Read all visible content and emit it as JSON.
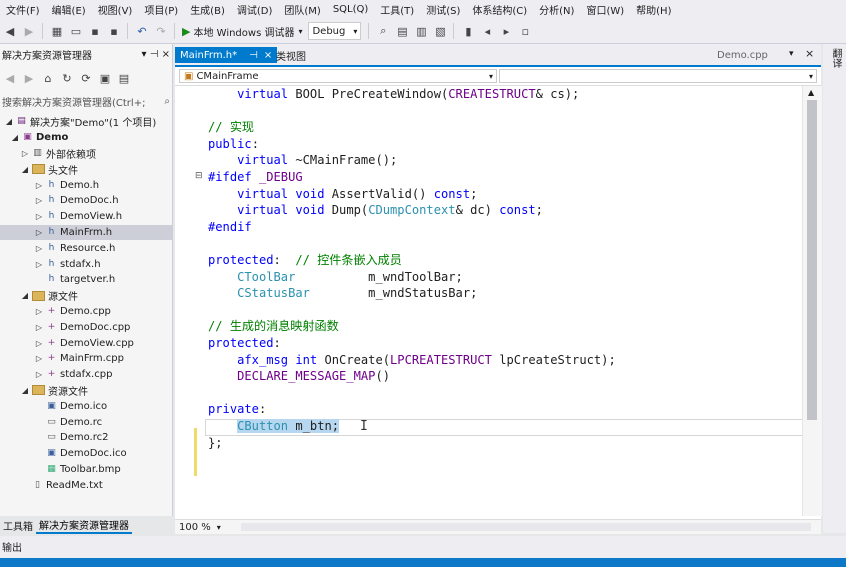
{
  "menu": [
    "文件(F)",
    "编辑(E)",
    "视图(V)",
    "项目(P)",
    "生成(B)",
    "调试(D)",
    "团队(M)",
    "SQL(Q)",
    "工具(T)",
    "测试(S)",
    "体系结构(C)",
    "分析(N)",
    "窗口(W)",
    "帮助(H)"
  ],
  "toolbar": {
    "debug_label": "本地 Windows 调试器",
    "config": "Debug"
  },
  "solution_explorer": {
    "title": "解决方案资源管理器",
    "search_placeholder": "搜索解决方案资源管理器(Ctrl+;",
    "solution_label": "解决方案\"Demo\"(1 个项目)",
    "project": "Demo",
    "external": "外部依赖项",
    "headers_folder": "头文件",
    "headers": [
      "Demo.h",
      "DemoDoc.h",
      "DemoView.h",
      "MainFrm.h",
      "Resource.h",
      "stdafx.h",
      "targetver.h"
    ],
    "sources_folder": "源文件",
    "sources": [
      "Demo.cpp",
      "DemoDoc.cpp",
      "DemoView.cpp",
      "MainFrm.cpp",
      "stdafx.cpp"
    ],
    "resources_folder": "资源文件",
    "resources": [
      "Demo.ico",
      "Demo.rc",
      "Demo.rc2",
      "DemoDoc.ico",
      "Toolbar.bmp"
    ],
    "readme": "ReadMe.txt"
  },
  "bottom_tabs": {
    "toolbox": "工具箱",
    "solution": "解决方案资源管理器"
  },
  "output_label": "输出",
  "editor": {
    "tabs": {
      "active": "MainFrm.h*",
      "pin": "⊣",
      "close": "×",
      "class_view": "类视图",
      "right_file": "Demo.cpp"
    },
    "nav_class": "CMainFrame",
    "zoom": "100 %"
  },
  "right_rail_label": "翻译"
}
